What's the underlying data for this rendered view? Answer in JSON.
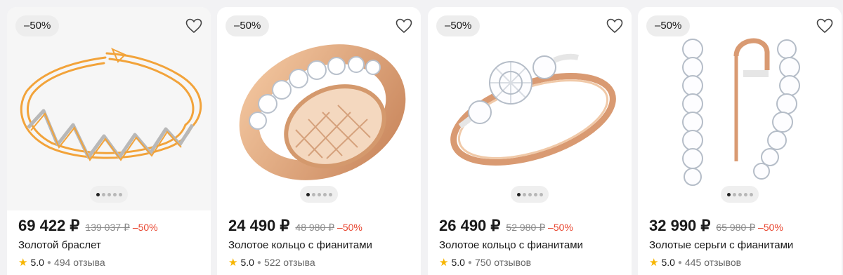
{
  "colors": {
    "discount": "#e8452f",
    "star": "#f7b500",
    "gold": "#f2a33a",
    "rose_gold": "#d99a72"
  },
  "products": [
    {
      "badge": "–50%",
      "price": "69 422 ₽",
      "old_price": "139 037 ₽",
      "discount": "–50%",
      "title": "Золотой браслет",
      "rating": "5.0",
      "reviews": "494 отзыва",
      "image_icon": "bracelet",
      "active_slide": 1,
      "slides": 5
    },
    {
      "badge": "–50%",
      "price": "24 490 ₽",
      "old_price": "48 980 ₽",
      "discount": "–50%",
      "title": "Золотое кольцо с фианитами",
      "rating": "5.0",
      "reviews": "522 отзыва",
      "image_icon": "ring-band",
      "active_slide": 1,
      "slides": 5
    },
    {
      "badge": "–50%",
      "price": "26 490 ₽",
      "old_price": "52 980 ₽",
      "discount": "–50%",
      "title": "Золотое кольцо с фианитами",
      "rating": "5.0",
      "reviews": "750 отзывов",
      "image_icon": "ring-solitaire",
      "active_slide": 1,
      "slides": 5
    },
    {
      "badge": "–50%",
      "price": "32 990 ₽",
      "old_price": "65 980 ₽",
      "discount": "–50%",
      "title": "Золотые серьги с фианитами",
      "rating": "5.0",
      "reviews": "445 отзывов",
      "image_icon": "earrings",
      "active_slide": 1,
      "slides": 5
    }
  ]
}
